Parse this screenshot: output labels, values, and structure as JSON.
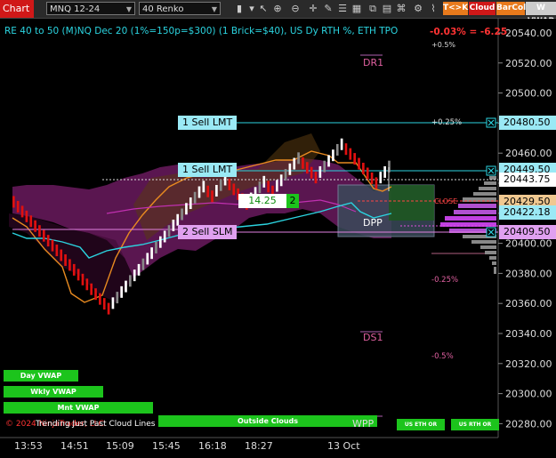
{
  "toolbar": {
    "chart_label": "Chart",
    "instrument": "MNQ 12-24",
    "bar_type": "40 Renko",
    "tk_label": "T<>K",
    "cloud_label": "Cloud",
    "barcol_label": "BarCol",
    "wvwap_label": "W VWAP",
    "icons": [
      "bar-chart-icon",
      "dropdown-icon",
      "pointer-icon",
      "zoom-in-icon",
      "zoom-out-icon",
      "crosshair-icon",
      "pencil-icon",
      "properties-icon",
      "layout-icon",
      "indicator-icon",
      "strategy-icon",
      "drawing-tools-icon",
      "settings-icon",
      "attach-icon"
    ],
    "accent_red": "#d01818",
    "accent_orange": "#e87a1c"
  },
  "header": {
    "info": "RE 40 to 50 (M)NQ Dec 20 (1%=150p=$300) (1 Brick=$40), US Dy RTH %, ETH TPO",
    "pct_change": "-0.03% = -6.25",
    "pct_plus": "+0.5%"
  },
  "price_axis": {
    "ticks": [
      "20540.00",
      "20520.00",
      "20500.00",
      "20480.00",
      "20460.00",
      "20440.00",
      "20420.00",
      "20400.00",
      "20380.00",
      "20360.00",
      "20340.00",
      "20320.00",
      "20300.00",
      "20280.00"
    ],
    "labels": {
      "sell_lmt_1": "20480.50",
      "sell_lmt_2": "20449.50",
      "last": "20443.75",
      "p1": "20429.50",
      "p2": "20422.18",
      "sell_slm": "20409.50"
    }
  },
  "time_axis": {
    "labels": [
      "13:53",
      "14:51",
      "15:09",
      "15:45",
      "16:18",
      "18:27",
      "13 Oct"
    ]
  },
  "orders": {
    "sell_lmt_1": "1 Sell LMT",
    "sell_lmt_2": "1 Sell LMT",
    "sell_slm": "2 Sell SLM",
    "position_value": "14.25",
    "position_qty": "2",
    "close_label": "CLOSE"
  },
  "levels": {
    "dr1": "DR1",
    "ds1": "DS1",
    "dpp": "DPP",
    "wpp": "WPP",
    "p025": "+0.25%",
    "m025": "-0.25%",
    "m05": "-0.5%"
  },
  "legend_bars": {
    "day_vwap": "Day VWAP",
    "wkly_vwap": "Wkly VWAP",
    "mnt_vwap": "Mnt VWAP",
    "outside_clouds": "Outside Clouds",
    "us_eth_or": "US ETH OR",
    "us_rth_or": "US RTH OR"
  },
  "footer": {
    "copyright": "© 2024 NinjaTrader, LLC",
    "overlay": "Trending Just Past Cloud Lines"
  }
}
